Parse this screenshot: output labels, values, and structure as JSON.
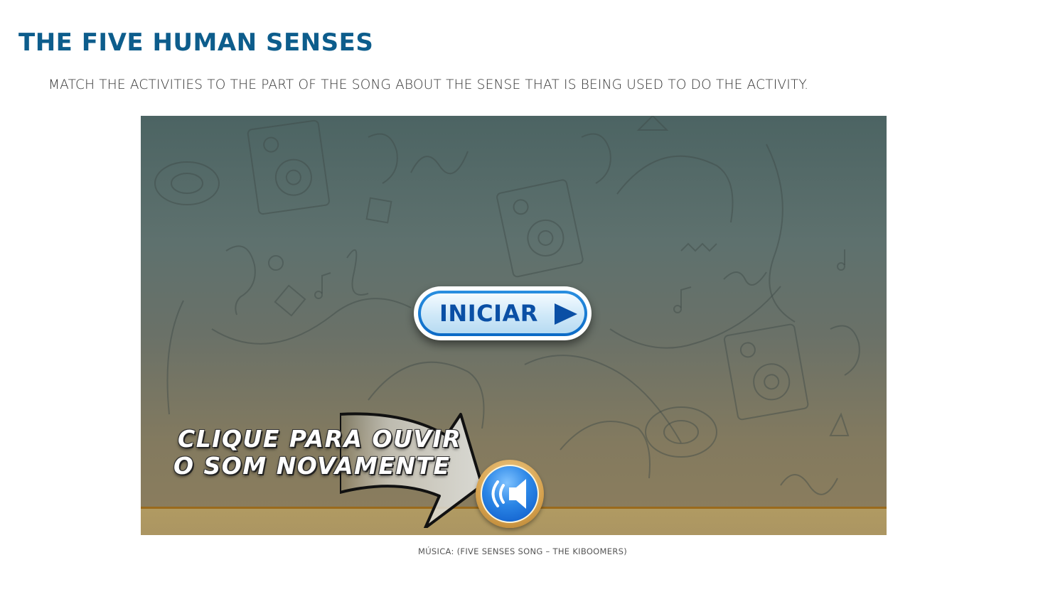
{
  "page": {
    "title": "THE FIVE HUMAN SENSES",
    "instructions": "MATCH THE ACTIVITIES TO THE PART OF THE SONG ABOUT THE SENSE THAT IS BEING USED TO DO THE ACTIVITY."
  },
  "game": {
    "start_button_label": "INICIAR",
    "replay_hint": {
      "line1": "CLIQUE PARA OUVIR",
      "line2": "O SOM NOVAMENTE"
    },
    "icons": {
      "start": "play-icon",
      "replay": "speaker-icon",
      "pointer": "arrow-icon"
    },
    "colors": {
      "title": "#0d5d8c",
      "button_blue": "#0b6ac6",
      "button_text": "#0a4fa5",
      "floor": "#ab9562"
    }
  },
  "caption": "MÚSICA: (FIVE SENSES SONG – THE KIBOOMERS)"
}
